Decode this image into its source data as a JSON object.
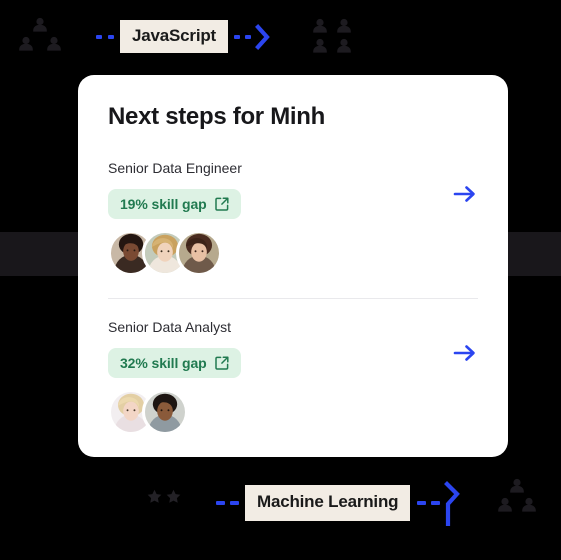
{
  "theme": {
    "background": "#000000",
    "band": "#19171b",
    "accent_blue": "#2b45f0",
    "tag_bg": "#f2ece4",
    "badge_bg": "#ddf2e4",
    "badge_text": "#217a50",
    "card_bg": "#ffffff",
    "divider": "#e9e9ec"
  },
  "decorations": {
    "top_left_cluster": "people-cluster-icon",
    "top_right_cluster": "people-grid-icon",
    "bottom_left_stars": "stars-icon",
    "bottom_right_cluster": "people-cluster-icon"
  },
  "connectors": {
    "top": {
      "tag_label": "JavaScript",
      "leading_dots_icon": "dotted-line-icon",
      "trailing_dots_icon": "dotted-line-icon",
      "chevron_icon": "chevron-right-icon"
    },
    "bottom": {
      "tag_label": "Machine Learning",
      "leading_dots_icon": "dotted-line-icon",
      "trailing_dots_icon": "dotted-line-icon",
      "chevron_icon": "chevron-right-down-icon"
    }
  },
  "card": {
    "title": "Next steps for Minh",
    "sections": [
      {
        "role": "Senior Data Engineer",
        "badge": "19% skill gap",
        "badge_icon": "external-link-icon",
        "arrow_icon": "arrow-right-icon",
        "avatars": [
          {
            "name": "avatar-1",
            "skin": "#7a4a33",
            "hair": "#241611",
            "bg": "#d8c9b8",
            "top": "#3a2a22"
          },
          {
            "name": "avatar-2",
            "skin": "#f0d3bc",
            "hair": "#c9a15e",
            "bg": "#c3cbbb",
            "top": "#efe7dd"
          },
          {
            "name": "avatar-3",
            "skin": "#e8c0a4",
            "hair": "#4a2c20",
            "bg": "#b6a98d",
            "top": "#6f5a4a"
          }
        ]
      },
      {
        "role": "Senior Data Analyst",
        "badge": "32% skill gap",
        "badge_icon": "external-link-icon",
        "arrow_icon": "arrow-right-icon",
        "avatars": [
          {
            "name": "avatar-4",
            "skin": "#f3d6c6",
            "hair": "#e3cfa4",
            "bg": "#f2eef0",
            "top": "#e9dfe2"
          },
          {
            "name": "avatar-5",
            "skin": "#8a5a3a",
            "hair": "#1d1512",
            "bg": "#cfd2cd",
            "top": "#8f9aa1"
          }
        ]
      }
    ]
  }
}
